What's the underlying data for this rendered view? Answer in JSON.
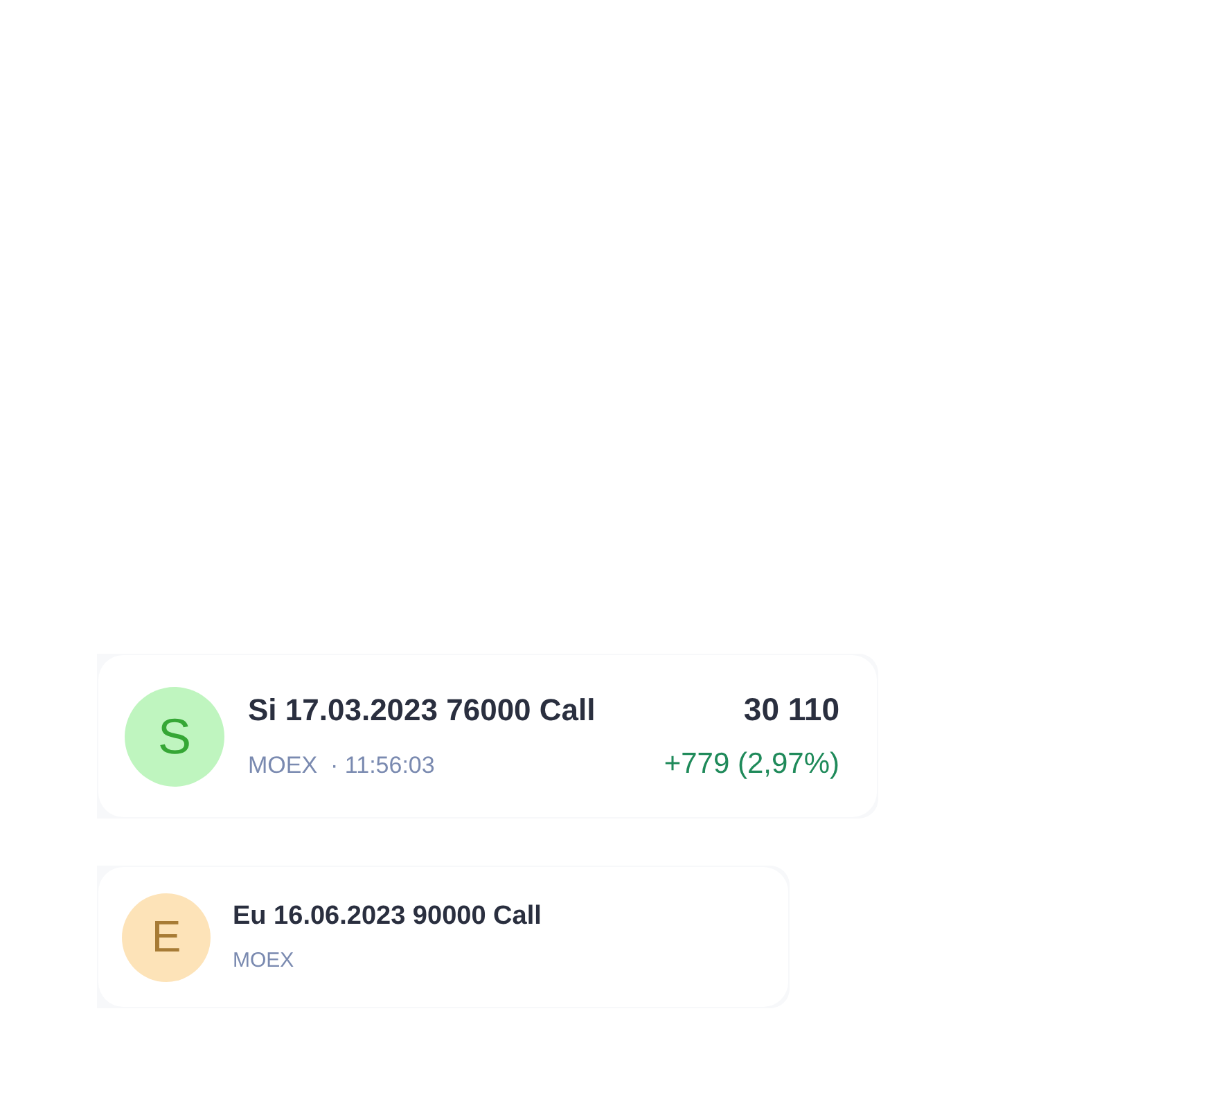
{
  "instruments": [
    {
      "letter": "S",
      "color": "#bff5bf",
      "name": "Si 17.03.2023 76000 Call",
      "exchange": "MOEX",
      "separator": "·",
      "time": "11:56:03",
      "price": "30 110",
      "change": "+779 (2,97%)"
    },
    {
      "letter": "E",
      "color": "#fde3b8",
      "name": "Eu 16.06.2023 90000 Call",
      "exchange": "MOEX"
    }
  ]
}
